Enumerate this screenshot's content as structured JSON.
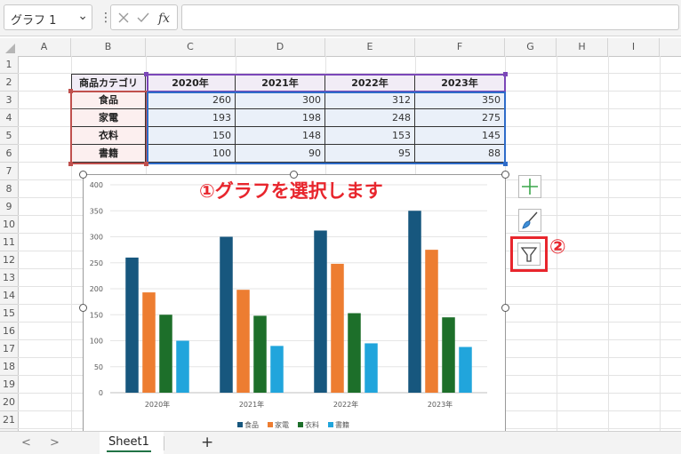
{
  "formula_bar": {
    "name_box": "グラフ 1",
    "formula_value": ""
  },
  "columns": [
    "A",
    "B",
    "C",
    "D",
    "E",
    "F",
    "G",
    "H",
    "I"
  ],
  "rows": [
    "1",
    "2",
    "3",
    "4",
    "5",
    "6",
    "7",
    "8",
    "9",
    "10",
    "11",
    "12",
    "13",
    "14",
    "15",
    "16",
    "17",
    "18",
    "19",
    "20",
    "21"
  ],
  "table": {
    "header": [
      "商品カテゴリ",
      "2020年",
      "2021年",
      "2022年",
      "2023年"
    ],
    "rows": [
      {
        "category": "食品",
        "values": [
          "260",
          "300",
          "312",
          "350"
        ]
      },
      {
        "category": "家電",
        "values": [
          "193",
          "198",
          "248",
          "275"
        ]
      },
      {
        "category": "衣料",
        "values": [
          "150",
          "148",
          "153",
          "145"
        ]
      },
      {
        "category": "書籍",
        "values": [
          "100",
          "90",
          "95",
          "88"
        ]
      }
    ]
  },
  "annotations": {
    "step1": "①グラフを選択します",
    "step2": "②"
  },
  "chart_side_buttons": [
    {
      "name": "chart-elements",
      "icon": "plus-icon"
    },
    {
      "name": "chart-styles",
      "icon": "paintbrush-icon"
    },
    {
      "name": "chart-filters",
      "icon": "funnel-filter-icon"
    }
  ],
  "sheet_tabs": {
    "active": "Sheet1",
    "prev": "<",
    "next": ">",
    "add": "+"
  },
  "colors": {
    "series_food": "#17577e",
    "series_appliance": "#ed7d31",
    "series_clothing": "#1d6f2a",
    "series_books": "#21a5dc",
    "annotation": "#e8262d",
    "header_range": "#7b47b8",
    "category_range": "#c0504d",
    "value_range": "#2e6cc9"
  },
  "chart_data": {
    "type": "bar",
    "categories": [
      "2020年",
      "2021年",
      "2022年",
      "2023年"
    ],
    "series": [
      {
        "name": "食品",
        "values": [
          260,
          300,
          312,
          350
        ]
      },
      {
        "name": "家電",
        "values": [
          193,
          198,
          248,
          275
        ]
      },
      {
        "name": "衣料",
        "values": [
          150,
          148,
          153,
          145
        ]
      },
      {
        "name": "書籍",
        "values": [
          100,
          90,
          95,
          88
        ]
      }
    ],
    "yticks": [
      "0",
      "50",
      "100",
      "150",
      "200",
      "250",
      "300",
      "350",
      "400"
    ],
    "ylim": [
      0,
      400
    ],
    "grid": true,
    "legend_position": "bottom",
    "title": "",
    "xlabel": "",
    "ylabel": ""
  }
}
